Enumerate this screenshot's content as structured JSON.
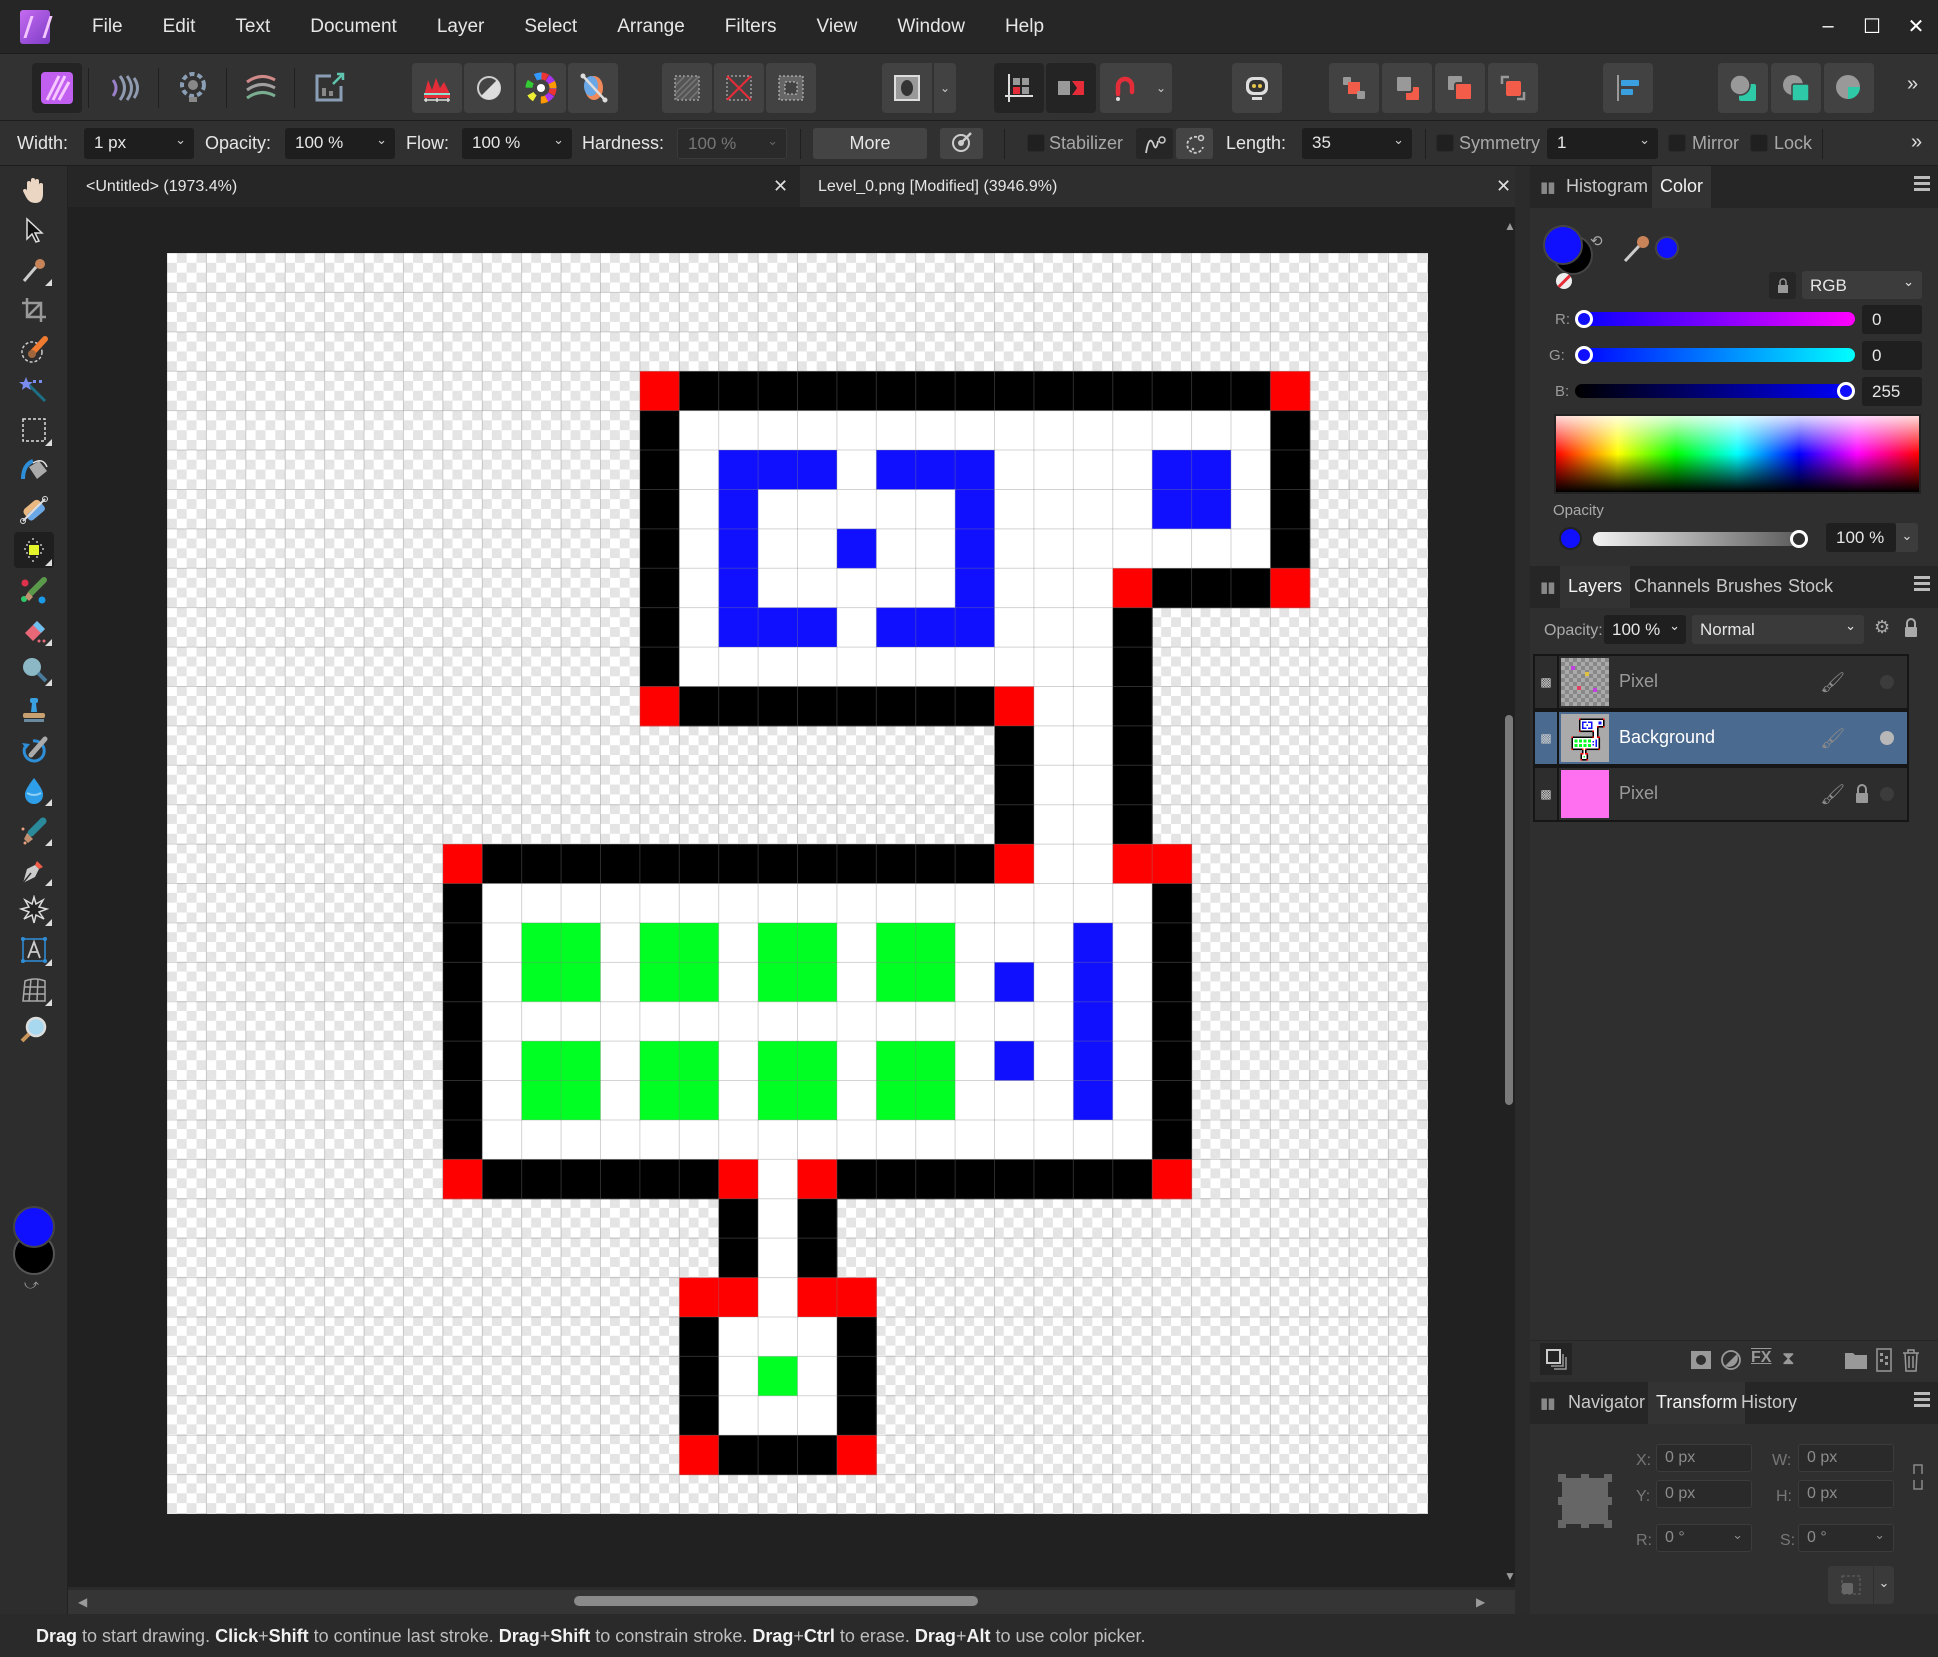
{
  "app": {
    "name": "Affinity Photo",
    "menu": [
      "File",
      "Edit",
      "Text",
      "Document",
      "Layer",
      "Select",
      "Arrange",
      "Filters",
      "View",
      "Window",
      "Help"
    ],
    "window_controls": {
      "minimize": "–",
      "maximize": "☐",
      "close": "✕"
    }
  },
  "toolbar": {
    "personas": [
      "photo-persona",
      "liquify-persona",
      "develop-persona",
      "tone-mapping-persona",
      "export-persona"
    ],
    "adjustments": [
      "levels",
      "white-balance",
      "hsl",
      "recolor"
    ],
    "selection": [
      "select-all",
      "deselect",
      "invert-selection"
    ],
    "quick_mask": "quick-mask",
    "snapping": [
      "force-pixel-alignment",
      "move-by-whole-pixels",
      "snapping"
    ],
    "assistant": "assistant",
    "arrange": [
      "move-to-back",
      "move-back-one",
      "move-forward-one",
      "move-to-front"
    ],
    "align": "align-left",
    "boolean": [
      "add",
      "subtract",
      "intersect"
    ],
    "overflow": "»"
  },
  "context": {
    "width_label": "Width:",
    "width_value": "1 px",
    "opacity_label": "Opacity:",
    "opacity_value": "100 %",
    "flow_label": "Flow:",
    "flow_value": "100 %",
    "hardness_label": "Hardness:",
    "hardness_value": "100 %",
    "more_label": "More",
    "stabilizer_label": "Stabilizer",
    "length_label": "Length:",
    "length_value": "35",
    "symmetry_label": "Symmetry",
    "symmetry_value": "1",
    "mirror_label": "Mirror",
    "lock_label": "Lock",
    "overflow": "»"
  },
  "tabs": [
    {
      "label": "<Untitled> (1973.4%)",
      "active": false
    },
    {
      "label": "Level_0.png [Modified] (3946.9%)",
      "active": true
    }
  ],
  "tools": [
    "view-tool",
    "move-tool",
    "color-picker-tool",
    "crop-tool",
    "selection-brush-tool",
    "flood-select-tool",
    "marquee-tool",
    "flood-fill-tool",
    "gradient-tool",
    "pixel-tool",
    "paint-mixer-tool",
    "erase-brush-tool",
    "dodge-tool",
    "clone-tool",
    "undo-brush-tool",
    "blur-tool",
    "healing-tool",
    "pen-tool",
    "shape-tool",
    "text-tool",
    "mesh-warp-tool",
    "zoom-tool"
  ],
  "colors": {
    "primary": "#1010ff",
    "secondary": "#000000",
    "wall": "#000000",
    "floor": "#ffffff",
    "door": "#ff0000",
    "blue": "#1010ff",
    "green": "#00ff22"
  },
  "canvas": {
    "document_size": "32 × 32 px",
    "palette": {
      "K": "#000000",
      "W": "#ffffff",
      "R": "#ff0000",
      "B": "#1010ff",
      "G": "#00ff22"
    },
    "pixels": [
      "................................",
      "................................",
      "................................",
      "............RKKKKKKKKKKKKKKKR...",
      "............KWWWWWWWWWWWWWWWK...",
      "............KWBBBWBBBWWWWBBWK...",
      "............KWBWWWWWBWWWWBBWK...",
      "............KWBWWBWWBWWWWWWWK...",
      "............KWBWWWWWBWWWRKKKR...",
      "............KWBBBWBBBWWWK.......",
      "............KWWWWWWWWWWWK.......",
      "............RKKKKKKKKRWWK.......",
      ".....................KWWK.......",
      ".....................KWWK.......",
      ".....................KWWK.......",
      ".......RKKKKKKKKKKKKKRWWRR......",
      ".......KWWWWWWWWWWWWWWWWWK......",
      ".......KWGGWGGWGGWGGWWWBWK......",
      ".......KWGGWGGWGGWGGWBWBWK......",
      ".......KWWWWWWWWWWWWWWWBWK......",
      ".......KWGGWGGWGGWGGWBWBWK......",
      ".......KWGGWGGWGGWGGWWWBWK......",
      ".......KWWWWWWWWWWWWWWWWWK......",
      ".......RKKKKKKRWRKKKKKKKKR......",
      "..............KWK...............",
      "..............KWK...............",
      ".............RRWRR..............",
      ".............KWWWK..............",
      ".............KWGWK..............",
      ".............KWWWK..............",
      ".............RKKKR..............",
      "................................"
    ]
  },
  "color_panel": {
    "tabs": [
      "Histogram",
      "Color"
    ],
    "active_tab": "Color",
    "mode": "RGB",
    "r_label": "R:",
    "r_value": "0",
    "g_label": "G:",
    "g_value": "0",
    "b_label": "B:",
    "b_value": "255",
    "r": 0,
    "g": 0,
    "b": 255,
    "opacity_label": "Opacity",
    "opacity_value": "100 %",
    "opacity": 1.0
  },
  "layers_panel": {
    "tabs": [
      "Layers",
      "Channels",
      "Brushes",
      "Stock"
    ],
    "active_tab": "Layers",
    "opacity_label": "Opacity:",
    "opacity_value": "100 %",
    "blend_mode": "Normal",
    "layers": [
      {
        "name": "Pixel",
        "selected": false,
        "locked": false,
        "visible": false
      },
      {
        "name": "Background",
        "selected": true,
        "locked": false,
        "visible": true
      },
      {
        "name": "Pixel",
        "selected": false,
        "locked": true,
        "visible": false
      }
    ]
  },
  "transform_panel": {
    "tabs": [
      "Navigator",
      "Transform",
      "History"
    ],
    "active_tab": "Transform",
    "x_label": "X:",
    "x_value": "0 px",
    "y_label": "Y:",
    "y_value": "0 px",
    "w_label": "W:",
    "w_value": "0 px",
    "h_label": "H:",
    "h_value": "0 px",
    "r_label": "R:",
    "r_value": "0 °",
    "s_label": "S:",
    "s_value": "0 °"
  },
  "status": {
    "segments": [
      {
        "bold": "Drag",
        "text": " to start drawing. "
      },
      {
        "bold": "Click",
        "text": "+"
      },
      {
        "bold": "Shift",
        "text": " to continue last stroke. "
      },
      {
        "bold": "Drag",
        "text": "+"
      },
      {
        "bold": "Shift",
        "text": " to constrain stroke. "
      },
      {
        "bold": "Drag",
        "text": "+"
      },
      {
        "bold": "Ctrl",
        "text": " to erase. "
      },
      {
        "bold": "Drag",
        "text": "+"
      },
      {
        "bold": "Alt",
        "text": " to use color picker."
      }
    ]
  }
}
